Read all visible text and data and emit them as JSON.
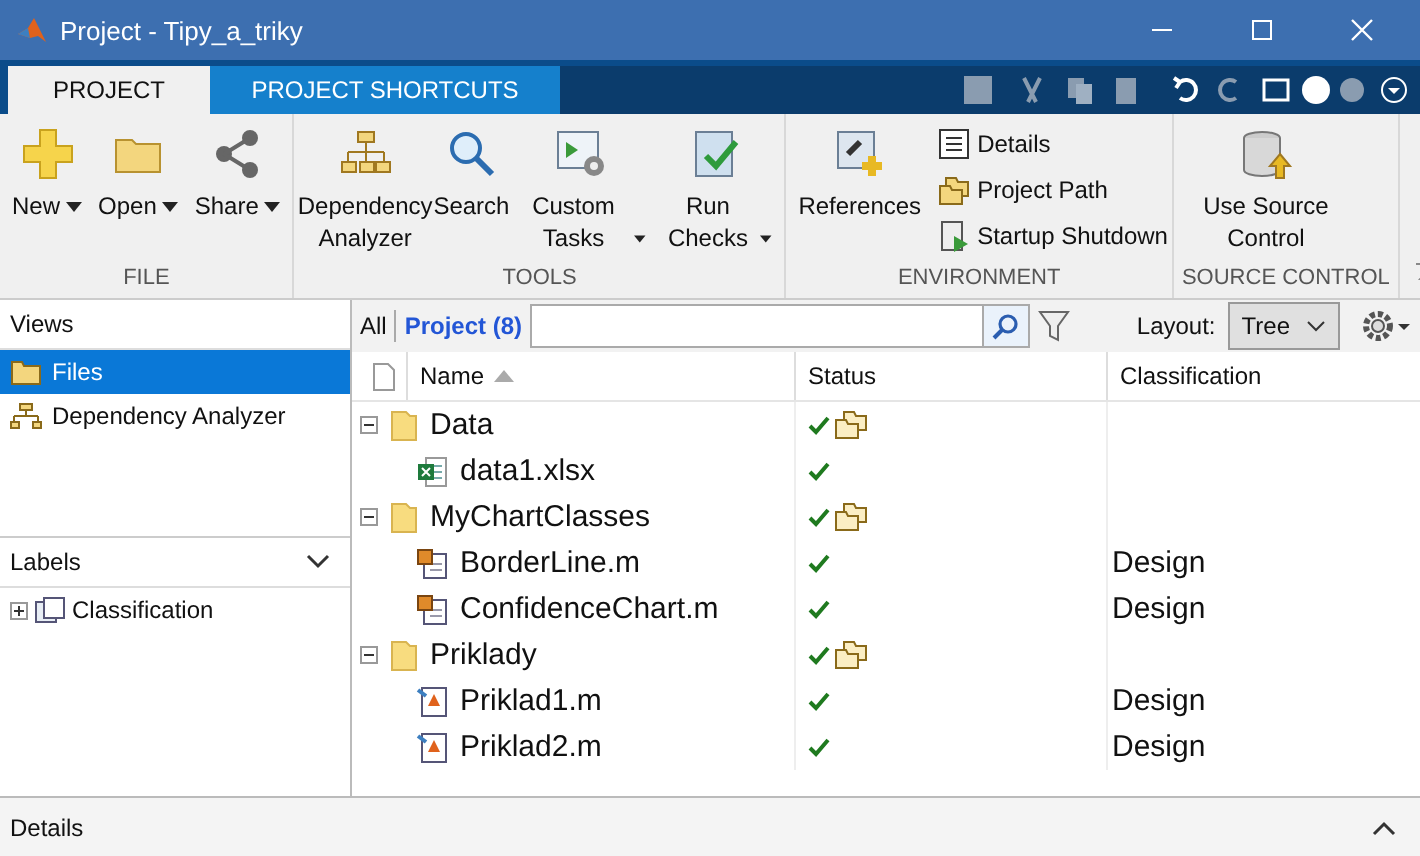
{
  "window": {
    "title": "Project - Tipy_a_triky"
  },
  "tabs": [
    {
      "label": "PROJECT",
      "selected": true
    },
    {
      "label": "PROJECT SHORTCUTS",
      "selected": false
    }
  ],
  "ribbon": [
    {
      "label": "FILE",
      "buttons": [
        {
          "kind": "large",
          "label": "New",
          "dropdown": true
        },
        {
          "kind": "large",
          "label": "Open",
          "dropdown": true
        },
        {
          "kind": "large",
          "label": "Share",
          "dropdown": true
        }
      ]
    },
    {
      "label": "TOOLS",
      "buttons": [
        {
          "kind": "large",
          "label": "Dependency Analyzer",
          "dropdown": false
        },
        {
          "kind": "large",
          "label": "Search",
          "dropdown": false
        },
        {
          "kind": "large",
          "label": "Custom Tasks",
          "dropdown": true
        },
        {
          "kind": "large",
          "label": "Run Checks",
          "dropdown": true
        }
      ]
    },
    {
      "label": "ENVIRONMENT",
      "buttons": [
        {
          "kind": "large",
          "label": "References",
          "dropdown": false
        },
        {
          "kind": "small",
          "label": "Details",
          "dropdown": false
        },
        {
          "kind": "small",
          "label": "Project Path",
          "dropdown": false
        },
        {
          "kind": "small",
          "label": "Startup Shutdown",
          "dropdown": false
        }
      ]
    },
    {
      "label": "SOURCE CONTROL",
      "buttons": [
        {
          "kind": "large",
          "label": "Use Source Control",
          "dropdown": false
        }
      ]
    }
  ],
  "views": {
    "title": "Views",
    "items": [
      {
        "label": "Files",
        "selected": true
      },
      {
        "label": "Dependency Analyzer",
        "selected": false
      }
    ]
  },
  "labels": {
    "title": "Labels",
    "items": [
      {
        "label": "Classification",
        "expanded": false
      }
    ]
  },
  "filter": {
    "scopes": [
      {
        "label": "All",
        "selected": false
      },
      {
        "label": "Project (8)",
        "selected": true
      }
    ],
    "layout_label": "Layout:",
    "layout_value": "Tree"
  },
  "table": {
    "columns": [
      {
        "label": "Name",
        "sorted": true
      },
      {
        "label": "Status",
        "sorted": false
      },
      {
        "label": "Classification",
        "sorted": false
      }
    ],
    "rows": [
      {
        "kind": "folder",
        "name": "Data",
        "expanded": true,
        "children": [
          {
            "kind": "excel",
            "name": "data1.xlsx"
          }
        ]
      },
      {
        "kind": "folder",
        "name": "MyChartClasses",
        "expanded": true,
        "children": [
          {
            "kind": "class",
            "name": "BorderLine.m",
            "classification": "Design"
          },
          {
            "kind": "class",
            "name": "ConfidenceChart.m",
            "classification": "Design"
          }
        ]
      },
      {
        "kind": "folder",
        "name": "Priklady",
        "expanded": true,
        "children": [
          {
            "kind": "script",
            "name": "Priklad1.m",
            "classification": "Design"
          },
          {
            "kind": "script",
            "name": "Priklad2.m",
            "classification": "Design"
          }
        ]
      }
    ]
  },
  "details": {
    "label": "Details"
  }
}
